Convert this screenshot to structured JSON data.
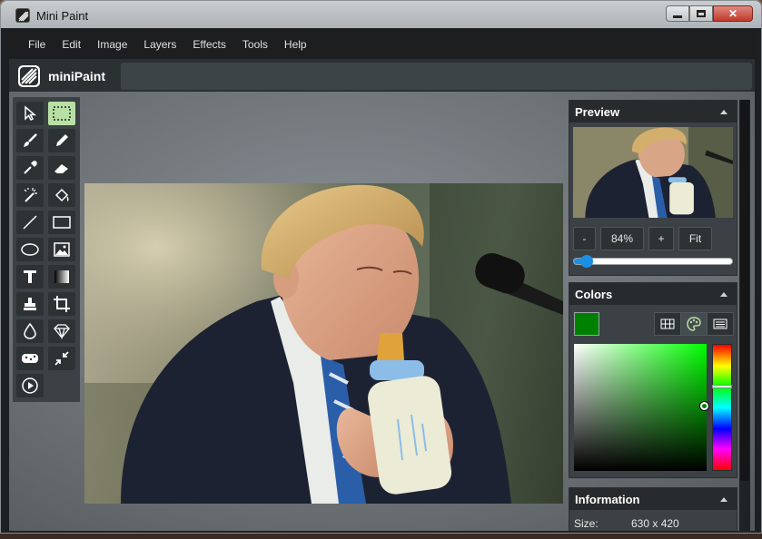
{
  "window": {
    "title": "Mini Paint",
    "minimize_label": "▬",
    "maximize_label": "□",
    "close_label": "✕"
  },
  "menu": {
    "items": [
      "File",
      "Edit",
      "Image",
      "Layers",
      "Effects",
      "Tools",
      "Help"
    ]
  },
  "header": {
    "app_name": "miniPaint"
  },
  "tools": [
    {
      "name": "select-tool",
      "icon": "cursor-icon"
    },
    {
      "name": "selection-tool",
      "icon": "dashed-rectangle-icon",
      "active": true
    },
    {
      "name": "brush-tool",
      "icon": "brush-icon"
    },
    {
      "name": "pencil-tool",
      "icon": "pencil-icon"
    },
    {
      "name": "color-picker-tool",
      "icon": "eyedropper-icon"
    },
    {
      "name": "erase-tool",
      "icon": "eraser-icon"
    },
    {
      "name": "magic-wand-tool",
      "icon": "magic-wand-icon"
    },
    {
      "name": "fill-tool",
      "icon": "paint-bucket-icon"
    },
    {
      "name": "line-tool",
      "icon": "line-icon"
    },
    {
      "name": "rectangle-tool",
      "icon": "rectangle-icon"
    },
    {
      "name": "ellipse-tool",
      "icon": "ellipse-icon"
    },
    {
      "name": "image-tool",
      "icon": "image-icon"
    },
    {
      "name": "text-tool",
      "icon": "text-icon"
    },
    {
      "name": "gradient-tool",
      "icon": "gradient-icon"
    },
    {
      "name": "clone-tool",
      "icon": "stamp-icon"
    },
    {
      "name": "crop-tool",
      "icon": "crop-icon"
    },
    {
      "name": "blur-tool",
      "icon": "drop-icon"
    },
    {
      "name": "sharpen-tool",
      "icon": "diamond-icon"
    },
    {
      "name": "desaturate-tool",
      "icon": "sponge-icon"
    },
    {
      "name": "bulge-pinch-tool",
      "icon": "compress-icon"
    },
    {
      "name": "animation-tool",
      "icon": "play-icon"
    }
  ],
  "preview": {
    "title": "Preview",
    "zoom_out_label": "-",
    "zoom_value": "84%",
    "zoom_in_label": "+",
    "fit_label": "Fit",
    "zoom_level": 0.84
  },
  "colors": {
    "title": "Colors",
    "active_color": "#008000",
    "picker_hue_color": "#00ff00"
  },
  "information": {
    "title": "Information",
    "size_label": "Size:",
    "size_value": "630 x 420"
  }
}
